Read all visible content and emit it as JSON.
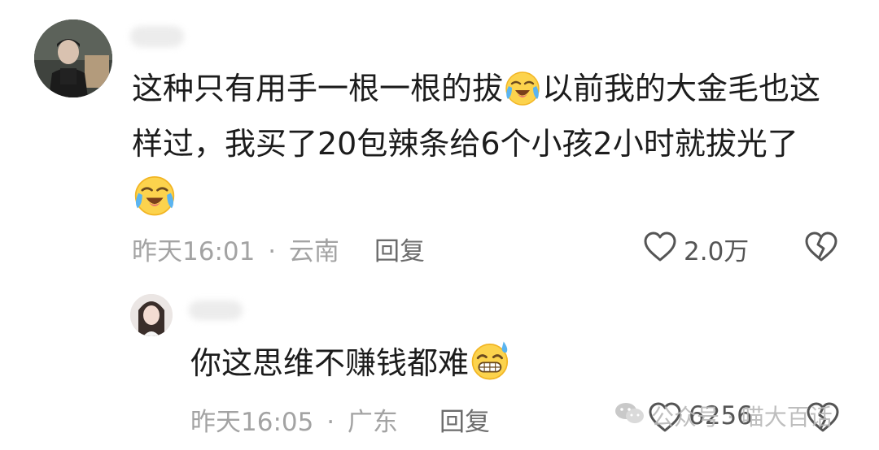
{
  "comment": {
    "line1_a": "这种只有用手一根一根的拔",
    "line1_b": "以前我的大金毛也这",
    "line2": "样过，我买了20包辣条给6个小孩2小时就拔光了",
    "time": "昨天16:01",
    "location": "云南",
    "separator": "·",
    "reply_label": "回复",
    "likes": "2.0万",
    "emoji": "crying-laughing-emoji"
  },
  "reply": {
    "text": "你这思维不赚钱都难",
    "time": "昨天16:05",
    "location": "广东",
    "separator": "·",
    "reply_label": "回复",
    "likes": "6256",
    "emoji": "grinning-sweat-emoji"
  },
  "watermark": {
    "text": "公众号 · 喵大百话"
  }
}
